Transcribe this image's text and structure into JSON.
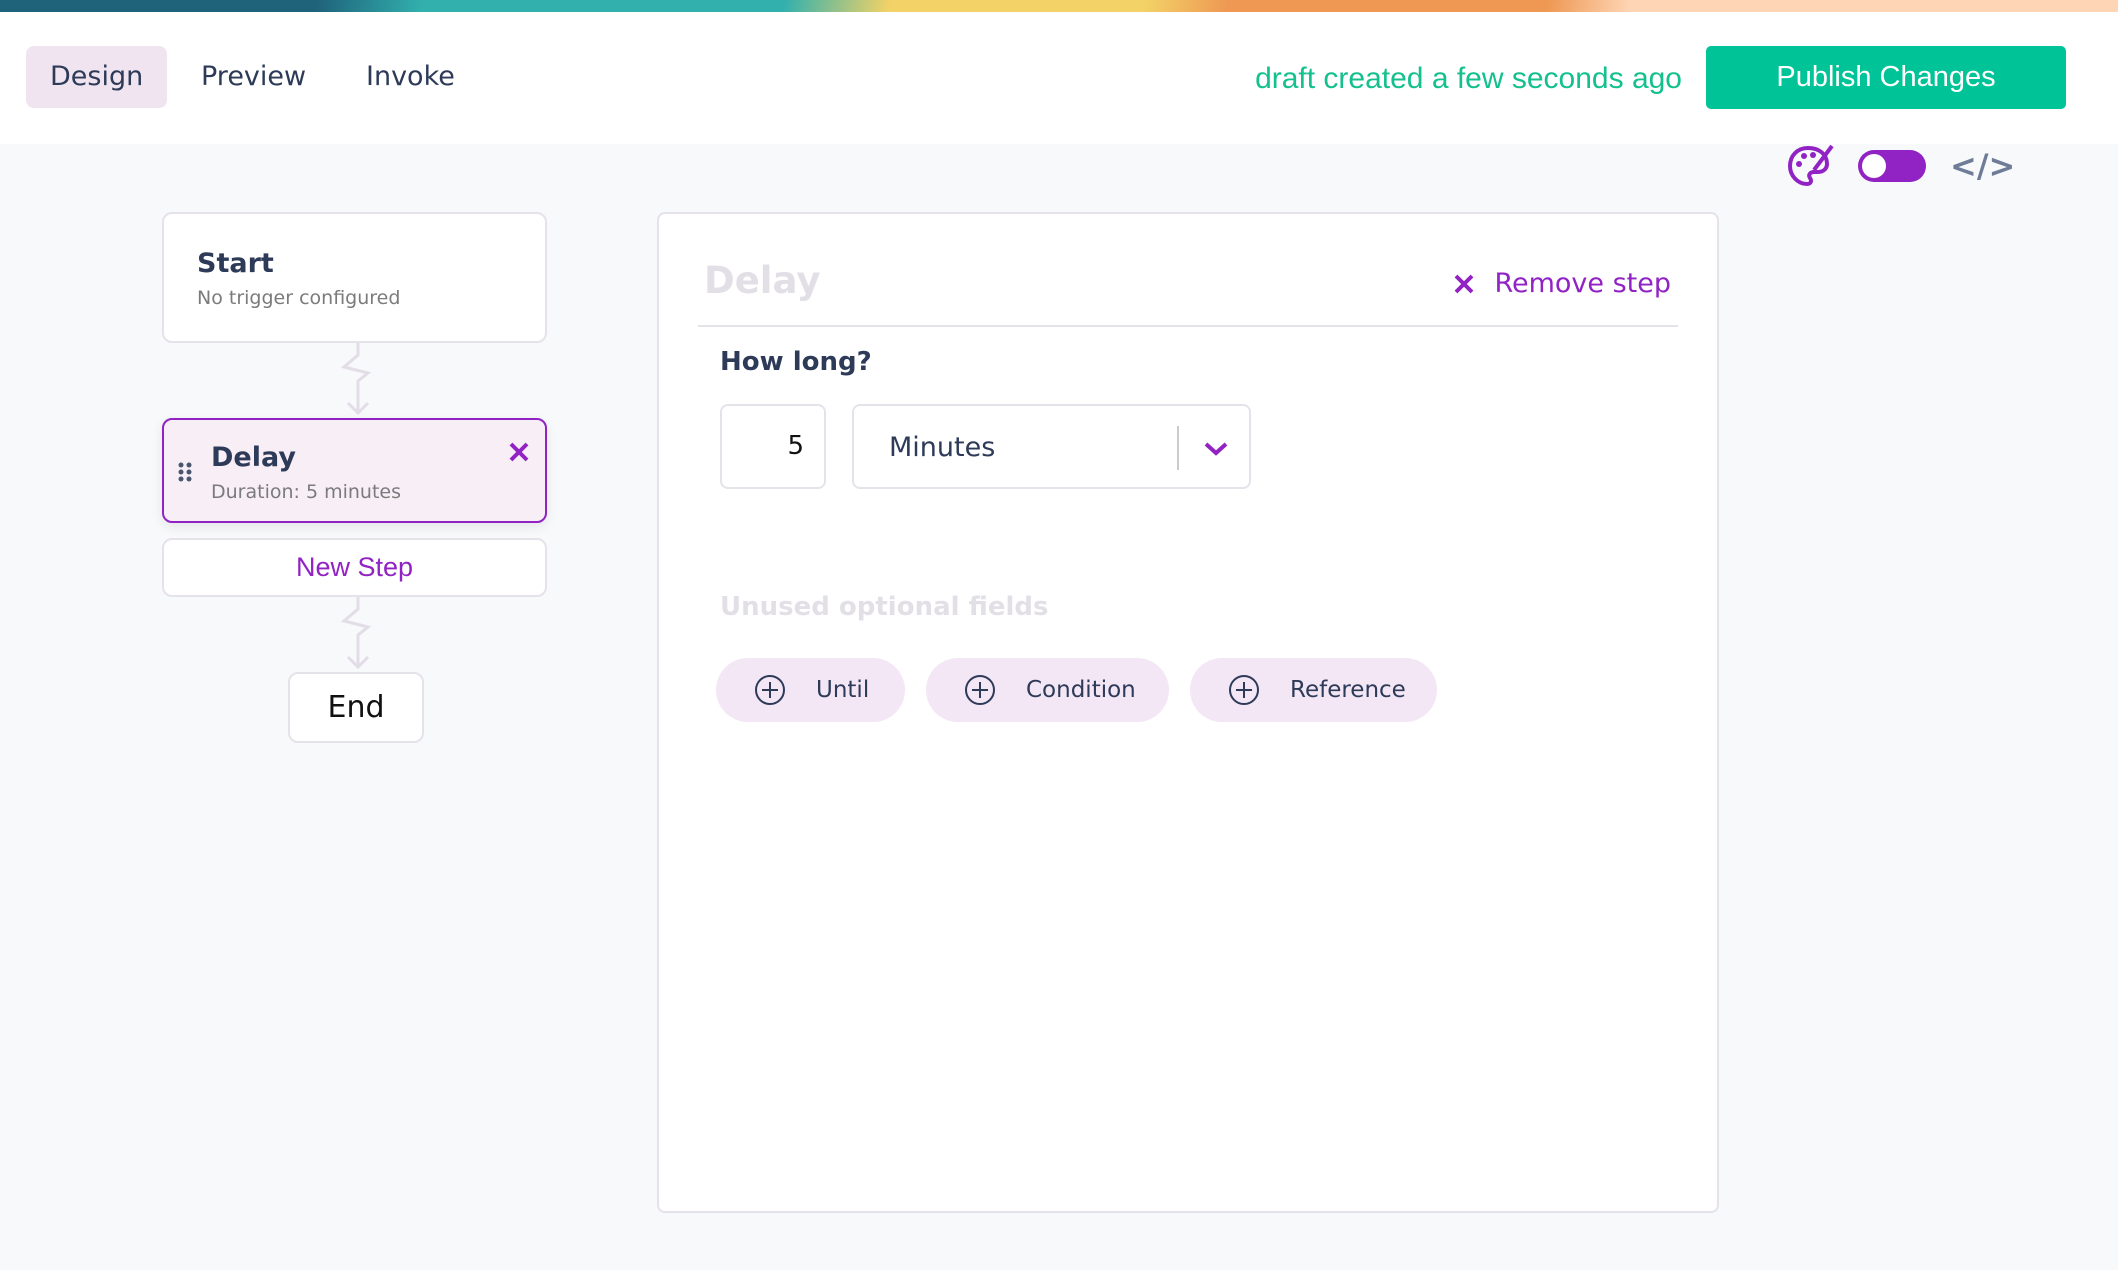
{
  "header": {
    "tabs": [
      {
        "label": "Design",
        "active": true
      },
      {
        "label": "Preview"
      },
      {
        "label": "Invoke"
      }
    ],
    "draft_status": "draft created a few seconds ago",
    "publish_label": "Publish Changes"
  },
  "toolbar": {
    "icons": [
      "palette-icon",
      "toggle-switch",
      "code-icon"
    ],
    "code_label": "</>"
  },
  "flow": {
    "start": {
      "title": "Start",
      "subtitle": "No trigger configured"
    },
    "delay": {
      "title": "Delay",
      "subtitle": "Duration: 5 minutes"
    },
    "new_step": "New Step",
    "end": "End"
  },
  "panel": {
    "title": "Delay",
    "remove_label": "Remove step",
    "how_long_label": "How long?",
    "duration_value": "5",
    "unit_value": "Minutes",
    "optional_label": "Unused optional fields",
    "optional_fields": [
      "Until",
      "Condition",
      "Reference"
    ]
  },
  "colors": {
    "accent": "#9122c4",
    "publish": "#00c498",
    "draft_text": "#14c08e"
  }
}
